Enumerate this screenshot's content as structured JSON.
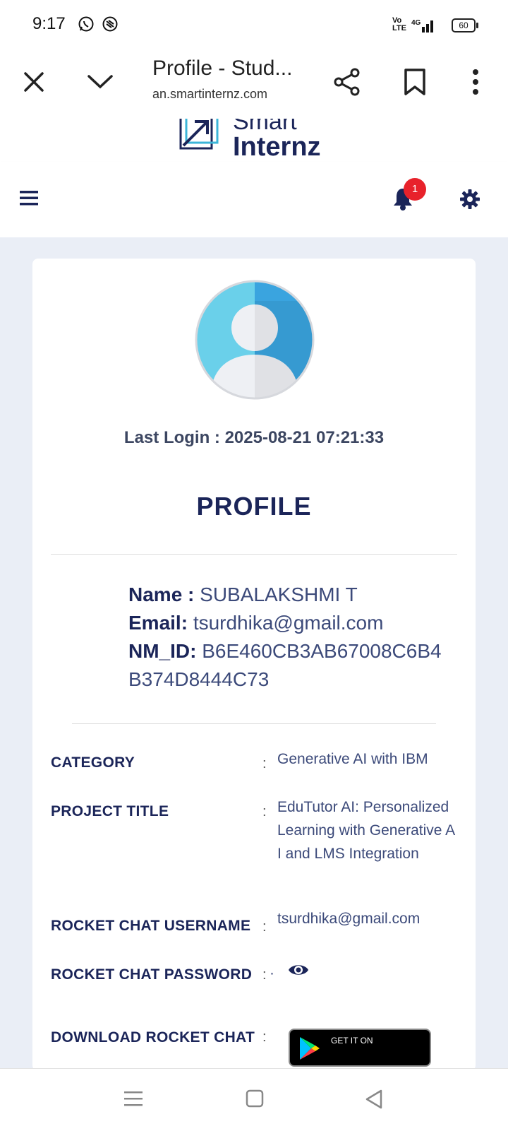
{
  "status_bar": {
    "time": "9:17",
    "network_label": "Vo LTE",
    "signal_label": "4G",
    "battery": "60"
  },
  "browser": {
    "page_title": "Profile - Stud...",
    "url": "an.smartinternz.com"
  },
  "site": {
    "logo_line1": "Smart",
    "logo_line2": "Internz",
    "notification_count": "1"
  },
  "profile": {
    "last_login": "Last Login : 2025-08-21 07:21:33",
    "heading": "PROFILE",
    "name_key": "Name :",
    "name_value": "SUBALAKSHMI T",
    "email_key": "Email:",
    "email_value": "tsurdhika@gmail.com",
    "nmid_key": "NM_ID:",
    "nmid_value": "B6E460CB3AB67008C6B4B374D8444C73"
  },
  "details": [
    {
      "label": "CATEGORY",
      "value": "Generative AI with IBM"
    },
    {
      "label": "PROJECT TITLE",
      "value": "EduTutor AI: Personalized Learning with Generative AI and LMS Integration"
    },
    {
      "label": "ROCKET CHAT USERNAME",
      "value": "tsurdhika@gmail.com"
    },
    {
      "label": "ROCKET CHAT PASSWORD",
      "value": "·"
    },
    {
      "label": "DOWNLOAD ROCKET CHAT",
      "value": "GET IT ON"
    }
  ],
  "colors": {
    "brand": "#1b2559",
    "badge": "#e8222b",
    "page_bg": "#eaeef6"
  }
}
